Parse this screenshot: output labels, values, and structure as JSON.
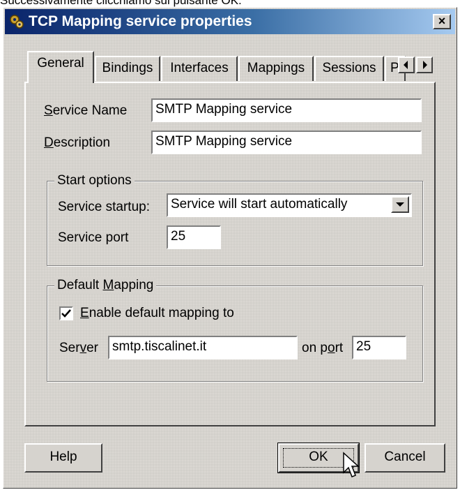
{
  "caption": "Successivamente clicchiamo sul pulsante OK.",
  "window": {
    "title": "TCP Mapping service properties",
    "close_label": "×"
  },
  "tabs": [
    {
      "label": "General",
      "active": true
    },
    {
      "label": "Bindings"
    },
    {
      "label": "Interfaces"
    },
    {
      "label": "Mappings"
    },
    {
      "label": "Sessions"
    },
    {
      "label": "P"
    }
  ],
  "general": {
    "service_name": {
      "label_u": "S",
      "label_rest": "ervice Name",
      "value": "SMTP Mapping service"
    },
    "description": {
      "label_u": "D",
      "label_rest": "escription",
      "value": "SMTP Mapping service"
    }
  },
  "start_options": {
    "title": "Start options",
    "startup_label": "Service startup:",
    "startup_value": "Service will start automatically",
    "port_label": "Service port",
    "port_value": "25"
  },
  "default_mapping": {
    "title_pre": "Default ",
    "title_u": "M",
    "title_post": "apping",
    "enable_u": "E",
    "enable_rest": "nable default mapping to",
    "enabled": true,
    "server_pre": "Ser",
    "server_u": "v",
    "server_post": "er",
    "server_value": "smtp.tiscalinet.it",
    "port_pre": "on p",
    "port_u": "o",
    "port_post": "rt",
    "port_value": "25"
  },
  "buttons": {
    "help": "Help",
    "ok": "OK",
    "cancel": "Cancel"
  }
}
